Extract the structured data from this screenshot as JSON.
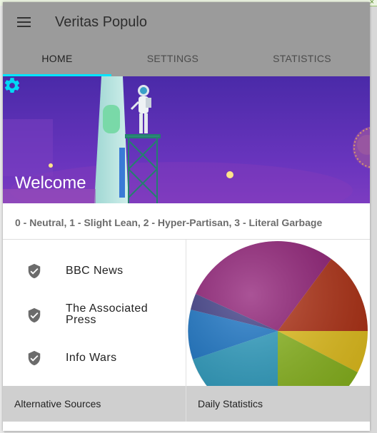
{
  "app": {
    "title": "Veritas Populo"
  },
  "tabs": [
    {
      "label": "HOME",
      "active": true
    },
    {
      "label": "SETTINGS",
      "active": false
    },
    {
      "label": "STATISTICS",
      "active": false
    }
  ],
  "hero": {
    "welcome": "Welcome"
  },
  "legend": {
    "text": "0 - Neutral, 1 - Slight Lean, 2 - Hyper-Partisan, 3 - Literal Garbage"
  },
  "sources": {
    "items": [
      {
        "label": "BBC News",
        "icon": "shield-check-icon"
      },
      {
        "label": "The Associated Press",
        "icon": "shield-check-icon"
      },
      {
        "label": "Info Wars",
        "icon": "shield-check-icon"
      }
    ],
    "footer": "Alternative Sources"
  },
  "stats": {
    "footer": "Daily Statistics"
  },
  "colors": {
    "accent": "#00e5ff",
    "appbar": "#9b9b9b",
    "hero_bg": "#5a2fb5",
    "footer_bg": "#cfcfcf"
  }
}
